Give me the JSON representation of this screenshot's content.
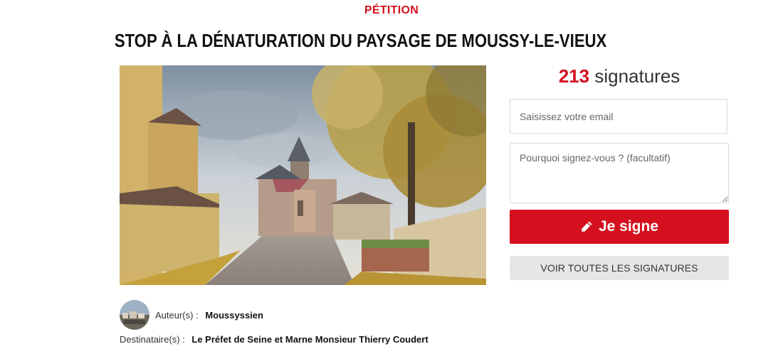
{
  "header": {
    "label": "PÉTITION",
    "title": "STOP À LA DÉNATURATION DU PAYSAGE DE MOUSSY-LE-VIEUX"
  },
  "signatures": {
    "count": "213",
    "label": "signatures"
  },
  "form": {
    "email_placeholder": "Saisissez votre email",
    "reason_placeholder": "Pourquoi signez-vous ? (facultatif)",
    "sign_label": "Je signe",
    "sign_icon": "pencil-icon",
    "all_signatures_label": "VOIR TOUTES LES SIGNATURES"
  },
  "meta": {
    "author_label": "Auteur(s) :",
    "author_name": "Moussyssien",
    "recipient_label": "Destinataire(s) :",
    "recipient_name": "Le Préfet de Seine et Marne Monsieur Thierry Coudert"
  },
  "colors": {
    "accent": "#d4101e",
    "secondary_button": "#e6e6e6"
  }
}
